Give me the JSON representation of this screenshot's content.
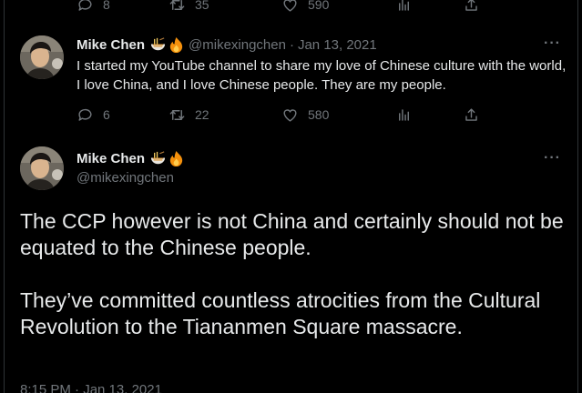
{
  "top_actions": {
    "replies": "8",
    "retweets": "35",
    "likes": "590"
  },
  "reply_tweet": {
    "author_name": "Mike Chen",
    "emoji": [
      "noodle-bowl-icon",
      "fire-icon"
    ],
    "handle": "@mikexingchen",
    "separator": "·",
    "date": "Jan 13, 2021",
    "text": "I started my YouTube channel to share my love of Chinese culture with the world, I love China, and I love Chinese people. They are my people.",
    "replies": "6",
    "retweets": "22",
    "likes": "580"
  },
  "main_tweet": {
    "author_name": "Mike Chen",
    "handle": "@mikexingchen",
    "paragraph_1": "The CCP however is not China and certainly should not be equated to the Chinese people.",
    "paragraph_2": "They’ve committed countless atrocities from the Cultural Revolution to the Tiananmen Square massacre.",
    "timestamp": "8:15 PM · Jan 13, 2021"
  },
  "more_label": "···",
  "colors": {
    "background": "#000000",
    "text": "#e7e9ea",
    "muted": "#71767b",
    "border": "#2f3336"
  }
}
